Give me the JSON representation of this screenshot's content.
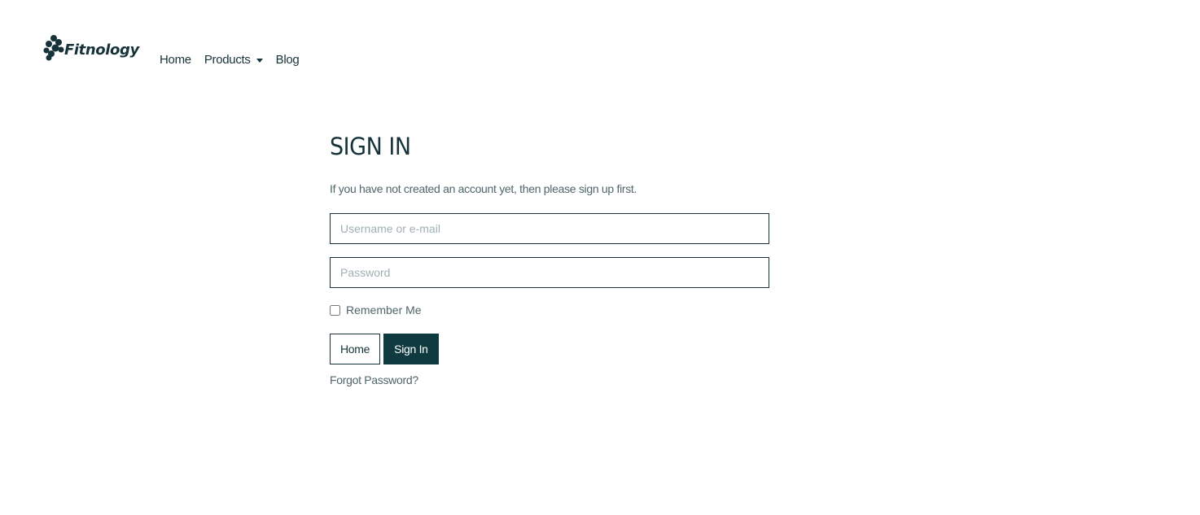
{
  "brand": {
    "name": "Fitnology",
    "color": "#17333a"
  },
  "nav": {
    "items": [
      {
        "label": "Home"
      },
      {
        "label": "Products",
        "has_dropdown": true
      },
      {
        "label": "Blog"
      }
    ]
  },
  "signin": {
    "title": "SIGN IN",
    "intro": "If you have not created an account yet, then please sign up first.",
    "username_placeholder": "Username or e-mail",
    "password_placeholder": "Password",
    "remember_label": "Remember Me",
    "remember_checked": false,
    "home_button": "Home",
    "signin_button": "Sign In",
    "forgot_link": "Forgot Password?"
  },
  "colors": {
    "primary": "#0e3a40",
    "text": "#17333a",
    "muted": "#4f6569"
  },
  "icons": {
    "brand_mark": "fitnology-logo-icon",
    "dropdown": "caret-down-icon"
  }
}
